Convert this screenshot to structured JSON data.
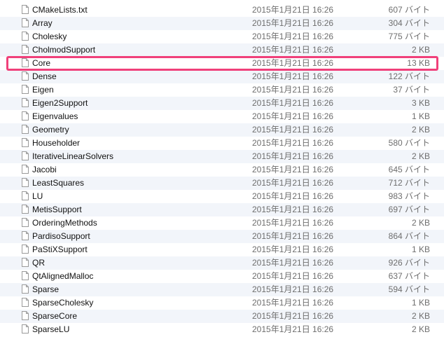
{
  "files": [
    {
      "name": "CMakeLists.txt",
      "date": "2015年1月21日 16:26",
      "size": "607 バイト"
    },
    {
      "name": "Array",
      "date": "2015年1月21日 16:26",
      "size": "304 バイト"
    },
    {
      "name": "Cholesky",
      "date": "2015年1月21日 16:26",
      "size": "775 バイト"
    },
    {
      "name": "CholmodSupport",
      "date": "2015年1月21日 16:26",
      "size": "2 KB"
    },
    {
      "name": "Core",
      "date": "2015年1月21日 16:26",
      "size": "13 KB"
    },
    {
      "name": "Dense",
      "date": "2015年1月21日 16:26",
      "size": "122 バイト"
    },
    {
      "name": "Eigen",
      "date": "2015年1月21日 16:26",
      "size": "37 バイト"
    },
    {
      "name": "Eigen2Support",
      "date": "2015年1月21日 16:26",
      "size": "3 KB"
    },
    {
      "name": "Eigenvalues",
      "date": "2015年1月21日 16:26",
      "size": "1 KB"
    },
    {
      "name": "Geometry",
      "date": "2015年1月21日 16:26",
      "size": "2 KB"
    },
    {
      "name": "Householder",
      "date": "2015年1月21日 16:26",
      "size": "580 バイト"
    },
    {
      "name": "IterativeLinearSolvers",
      "date": "2015年1月21日 16:26",
      "size": "2 KB"
    },
    {
      "name": "Jacobi",
      "date": "2015年1月21日 16:26",
      "size": "645 バイト"
    },
    {
      "name": "LeastSquares",
      "date": "2015年1月21日 16:26",
      "size": "712 バイト"
    },
    {
      "name": "LU",
      "date": "2015年1月21日 16:26",
      "size": "983 バイト"
    },
    {
      "name": "MetisSupport",
      "date": "2015年1月21日 16:26",
      "size": "697 バイト"
    },
    {
      "name": "OrderingMethods",
      "date": "2015年1月21日 16:26",
      "size": "2 KB"
    },
    {
      "name": "PardisoSupport",
      "date": "2015年1月21日 16:26",
      "size": "864 バイト"
    },
    {
      "name": "PaStiXSupport",
      "date": "2015年1月21日 16:26",
      "size": "1 KB"
    },
    {
      "name": "QR",
      "date": "2015年1月21日 16:26",
      "size": "926 バイト"
    },
    {
      "name": "QtAlignedMalloc",
      "date": "2015年1月21日 16:26",
      "size": "637 バイト"
    },
    {
      "name": "Sparse",
      "date": "2015年1月21日 16:26",
      "size": "594 バイト"
    },
    {
      "name": "SparseCholesky",
      "date": "2015年1月21日 16:26",
      "size": "1 KB"
    },
    {
      "name": "SparseCore",
      "date": "2015年1月21日 16:26",
      "size": "2 KB"
    },
    {
      "name": "SparseLU",
      "date": "2015年1月21日 16:26",
      "size": "2 KB"
    }
  ],
  "highlighted_file": "Core",
  "icons": {
    "file": "document-icon"
  },
  "colors": {
    "highlight_border": "#f0407a",
    "alt_row": "#f2f5fa",
    "secondary_text": "#6e6e6e"
  }
}
